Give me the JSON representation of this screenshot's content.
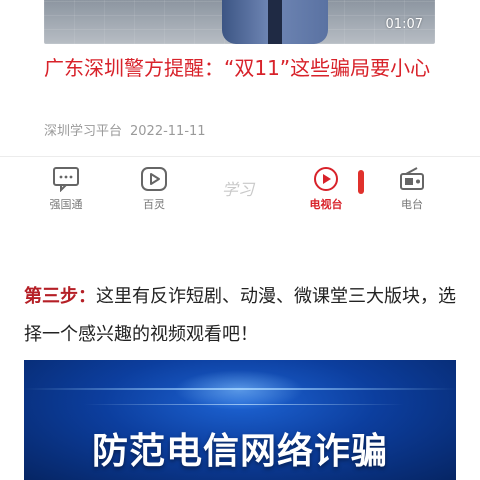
{
  "video": {
    "duration": "01:07",
    "title": "广东深圳警方提醒：“双11”这些骗局要小心",
    "source": "深圳学习平台",
    "date": "2022-11-11"
  },
  "tabbar": {
    "items": [
      {
        "label": "强国通",
        "icon": "chat-icon",
        "active": false
      },
      {
        "label": "百灵",
        "icon": "play-tv-icon",
        "active": false
      },
      {
        "label": "电视台",
        "icon": "play-circle-icon",
        "active": true
      },
      {
        "label": "电台",
        "icon": "radio-icon",
        "active": false
      }
    ],
    "center_logo": "学习",
    "active_color": "#d8222a"
  },
  "step": {
    "label": "第三步：",
    "text": "这里有反诈短剧、动漫、微课堂三大版块，选择一个感兴趣的视频观看吧！"
  },
  "banner": {
    "title": "防范电信网络诈骗"
  }
}
